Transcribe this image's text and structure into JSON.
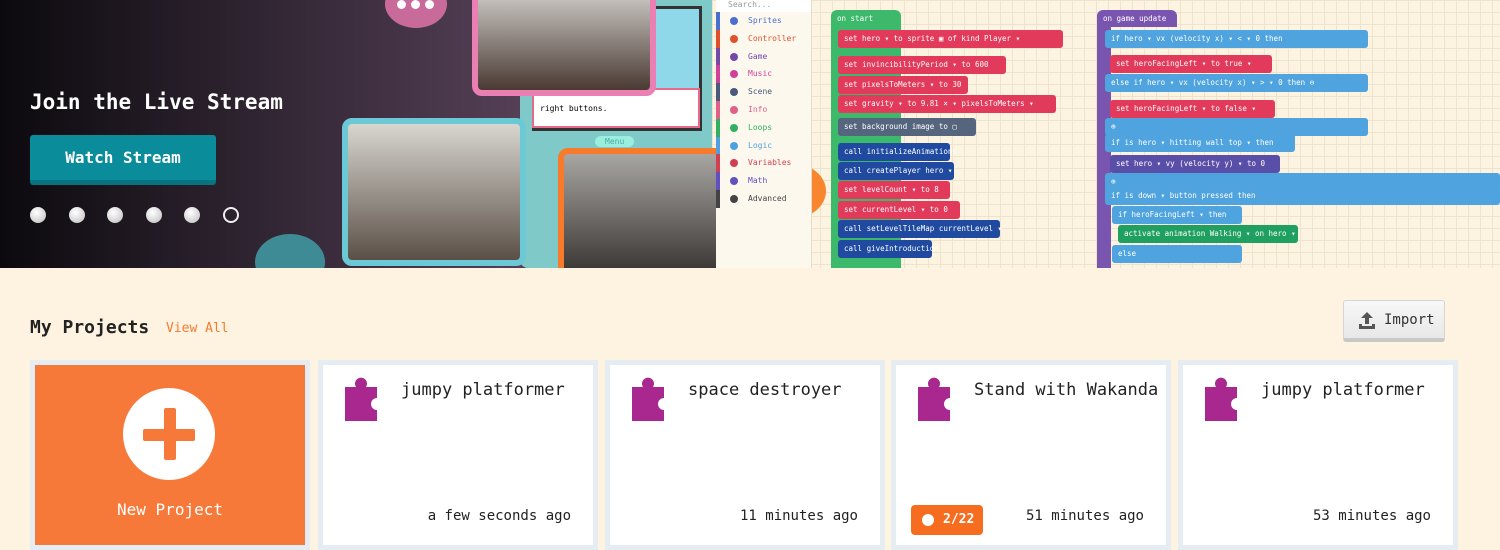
{
  "banner": {
    "title": "Join the Live Stream",
    "button": "Watch Stream",
    "carousel_dots": 6,
    "active_dot": 6,
    "image_text": {
      "toolbox_search": "Search...",
      "toolbox": [
        "Sprites",
        "Controller",
        "Game",
        "Music",
        "Scene",
        "Info",
        "Loops",
        "Logic",
        "Variables",
        "Math",
        "Advanced"
      ],
      "game_dialog": "right buttons.",
      "menu": "Menu",
      "on_start": [
        "on start",
        "set hero ▾ to sprite ▣ of kind Player ▾",
        "set invincibilityPeriod ▾ to 600",
        "set pixelsToMeters ▾ to 30",
        "set gravity ▾ to 9.81 × ▾ pixelsToMeters ▾",
        "set background image to ▢",
        "call initializeAnimations",
        "call createPlayer hero ▾",
        "set levelCount ▾ to 8",
        "set currentLevel ▾ to 0",
        "call setLevelTileMap currentLevel ▾",
        "call giveIntroduction"
      ],
      "on_game_update": [
        "on game update",
        "if hero ▾ vx (velocity x) ▾ < ▾ 0 then",
        "set heroFacingLeft ▾ to true ▾",
        "else if hero ▾ vx (velocity x) ▾ > ▾ 0 then ⊖",
        "set heroFacingLeft ▾ to false ▾",
        "⊕",
        "if is hero ▾ hitting wall top ▾ then",
        "set hero ▾ vy (velocity y) ▾ to 0",
        "⊕",
        "if is down ▾ button pressed then",
        "if heroFacingLeft ▾ then",
        "activate animation Walking ▾ on hero ▾",
        "else"
      ]
    }
  },
  "projects": {
    "heading": "My Projects",
    "view_all": "View All",
    "import": "Import",
    "new_project": "New Project",
    "items": [
      {
        "title": "jumpy platformer",
        "time": "a few seconds ago"
      },
      {
        "title": "space destroyer",
        "time": "11 minutes ago"
      },
      {
        "title": "Stand with Wakanda",
        "time": "51 minutes ago",
        "badge": "2/22"
      },
      {
        "title": "jumpy platformer",
        "time": "53 minutes ago"
      }
    ]
  },
  "colors": {
    "accent": "#f7793a",
    "teal": "#0b8c9b",
    "puzzle": "#a8288f",
    "badge": "#f76d1f",
    "background": "#fef2e0"
  }
}
